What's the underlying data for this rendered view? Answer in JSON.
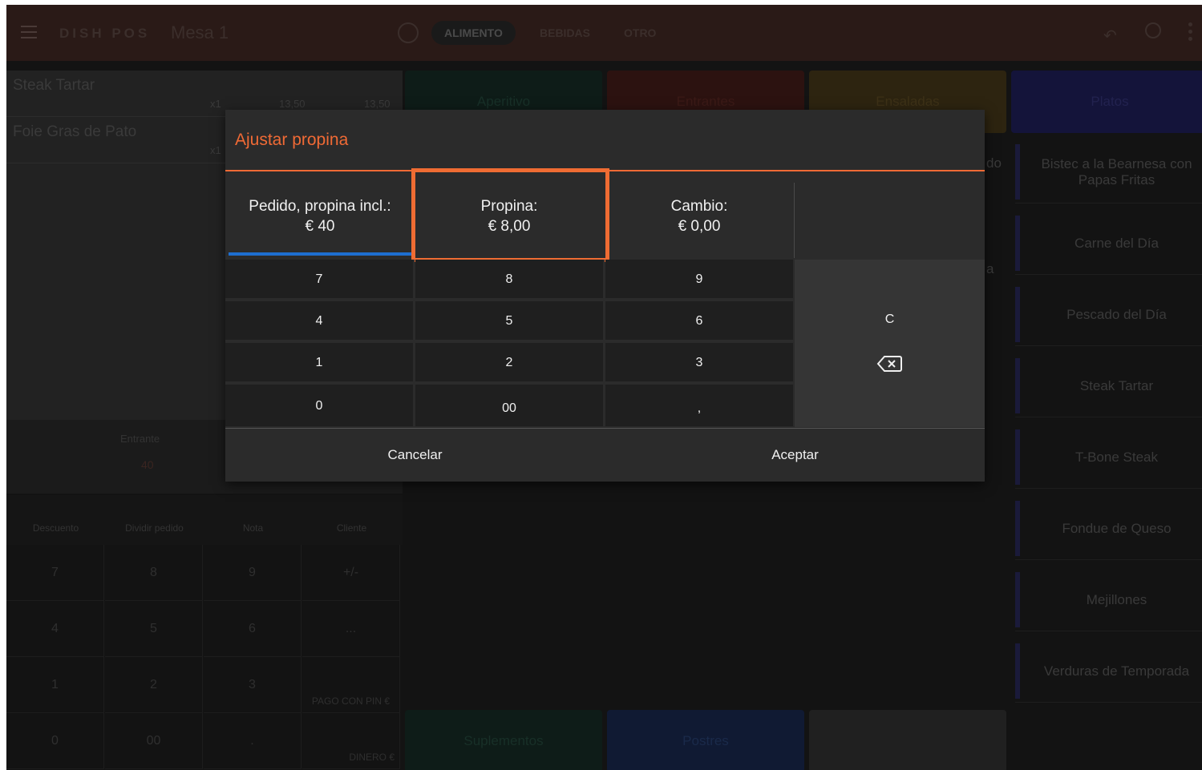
{
  "topbar": {
    "logo": "DISH POS",
    "table": "Mesa 1",
    "tabs": [
      "ALIMENTO",
      "BEBIDAS",
      "OTRO"
    ]
  },
  "order": {
    "items": [
      {
        "name": "Steak Tartar",
        "qty": "x1",
        "price": "13,50",
        "total": "13,50"
      },
      {
        "name": "Foie Gras de Pato",
        "qty": "x1",
        "price": "",
        "total": ""
      }
    ]
  },
  "summary": {
    "label": "Entrante",
    "value": "40"
  },
  "actions": [
    "Descuento",
    "Dividir pedido",
    "Nota",
    "Cliente"
  ],
  "bg_keypad": {
    "keys": [
      "7",
      "8",
      "9",
      "+/-",
      "4",
      "5",
      "6",
      "...",
      "1",
      "2",
      "3",
      "",
      "0",
      "00",
      ".",
      ""
    ],
    "pay_pin": "PAGO CON PIN €",
    "pay_cash": "DINERO €"
  },
  "categories": {
    "top": [
      "Aperitivo",
      "Entrantes",
      "Ensaladas",
      "Platos"
    ],
    "bottom": [
      "Suplementos",
      "Postres",
      ""
    ]
  },
  "products": [
    "Bistec a la Bearnesa con Papas Fritas",
    "Carne del Día",
    "Pescado del Día",
    "Steak Tartar",
    "T-Bone Steak",
    "Fondue de Queso",
    "Mejillones",
    "Verduras de Temporada"
  ],
  "partial": {
    "a": "do",
    "b": "a"
  },
  "dialog": {
    "title": "Ajustar propina",
    "cells": [
      {
        "label": "Pedido, propina incl.:",
        "value": "€ 40"
      },
      {
        "label": "Propina:",
        "value": "€ 8,00"
      },
      {
        "label": "Cambio:",
        "value": "€ 0,00"
      }
    ],
    "keys": [
      "7",
      "8",
      "9",
      "4",
      "5",
      "6",
      "1",
      "2",
      "3",
      "0",
      "00",
      ","
    ],
    "clear": "C",
    "cancel": "Cancelar",
    "accept": "Aceptar"
  },
  "colors": {
    "accent": "#f06a35",
    "tab_underline": "#1e6fd0",
    "dialog_bg": "#2b2b2b"
  }
}
